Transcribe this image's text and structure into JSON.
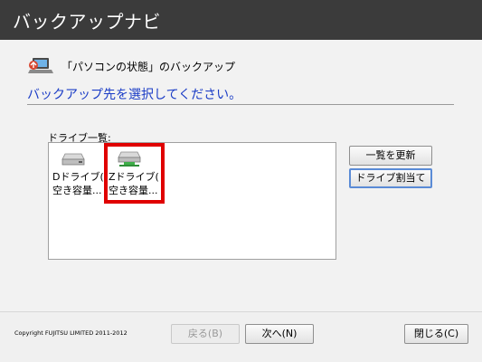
{
  "window": {
    "title": "バックアップナビ"
  },
  "header": {
    "icon": "laptop-backup-icon",
    "text": "「パソコンの状態」のバックアップ"
  },
  "instruction": "バックアップ先を選択してください。",
  "drive_list": {
    "label": "ドライブ一覧:",
    "items": [
      {
        "icon": "hard-drive-icon",
        "line1": "Dドライブ(",
        "line2": "空き容量...",
        "selected": false
      },
      {
        "icon": "network-drive-icon",
        "line1": "Zドライブ(",
        "line2": "空き容量...",
        "selected": true
      }
    ]
  },
  "buttons": {
    "refresh": "一覧を更新",
    "assign": "ドライブ割当て",
    "back": "戻る(B)",
    "next": "次へ(N)",
    "close": "閉じる(C)"
  },
  "footer": {
    "copyright": "Copyright FUJITSU LIMITED 2011-2012"
  },
  "colors": {
    "titlebar": "#3b3b3b",
    "instruction": "#1a3cc6",
    "highlight": "#e00000",
    "default_button_border": "#5a8bd6"
  }
}
